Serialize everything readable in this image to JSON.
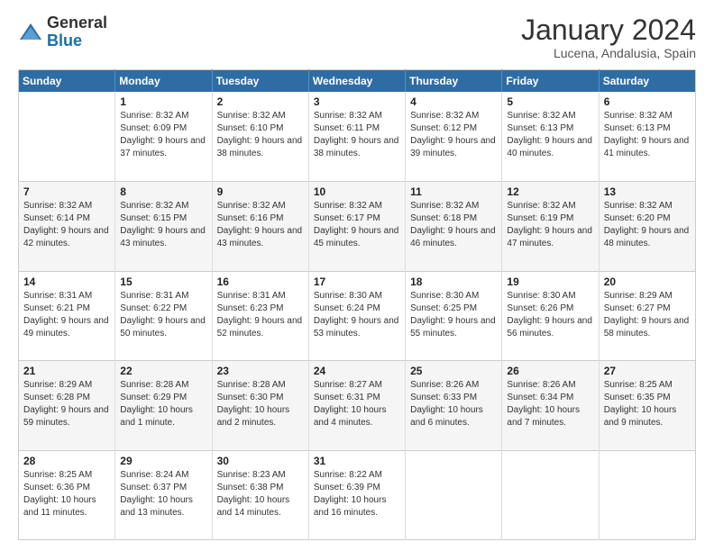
{
  "logo": {
    "general": "General",
    "blue": "Blue"
  },
  "title": "January 2024",
  "subtitle": "Lucena, Andalusia, Spain",
  "days_of_week": [
    "Sunday",
    "Monday",
    "Tuesday",
    "Wednesday",
    "Thursday",
    "Friday",
    "Saturday"
  ],
  "weeks": [
    [
      {
        "day": "",
        "sunrise": "",
        "sunset": "",
        "daylight": ""
      },
      {
        "day": "1",
        "sunrise": "Sunrise: 8:32 AM",
        "sunset": "Sunset: 6:09 PM",
        "daylight": "Daylight: 9 hours and 37 minutes."
      },
      {
        "day": "2",
        "sunrise": "Sunrise: 8:32 AM",
        "sunset": "Sunset: 6:10 PM",
        "daylight": "Daylight: 9 hours and 38 minutes."
      },
      {
        "day": "3",
        "sunrise": "Sunrise: 8:32 AM",
        "sunset": "Sunset: 6:11 PM",
        "daylight": "Daylight: 9 hours and 38 minutes."
      },
      {
        "day": "4",
        "sunrise": "Sunrise: 8:32 AM",
        "sunset": "Sunset: 6:12 PM",
        "daylight": "Daylight: 9 hours and 39 minutes."
      },
      {
        "day": "5",
        "sunrise": "Sunrise: 8:32 AM",
        "sunset": "Sunset: 6:13 PM",
        "daylight": "Daylight: 9 hours and 40 minutes."
      },
      {
        "day": "6",
        "sunrise": "Sunrise: 8:32 AM",
        "sunset": "Sunset: 6:13 PM",
        "daylight": "Daylight: 9 hours and 41 minutes."
      }
    ],
    [
      {
        "day": "7",
        "sunrise": "Sunrise: 8:32 AM",
        "sunset": "Sunset: 6:14 PM",
        "daylight": "Daylight: 9 hours and 42 minutes."
      },
      {
        "day": "8",
        "sunrise": "Sunrise: 8:32 AM",
        "sunset": "Sunset: 6:15 PM",
        "daylight": "Daylight: 9 hours and 43 minutes."
      },
      {
        "day": "9",
        "sunrise": "Sunrise: 8:32 AM",
        "sunset": "Sunset: 6:16 PM",
        "daylight": "Daylight: 9 hours and 43 minutes."
      },
      {
        "day": "10",
        "sunrise": "Sunrise: 8:32 AM",
        "sunset": "Sunset: 6:17 PM",
        "daylight": "Daylight: 9 hours and 45 minutes."
      },
      {
        "day": "11",
        "sunrise": "Sunrise: 8:32 AM",
        "sunset": "Sunset: 6:18 PM",
        "daylight": "Daylight: 9 hours and 46 minutes."
      },
      {
        "day": "12",
        "sunrise": "Sunrise: 8:32 AM",
        "sunset": "Sunset: 6:19 PM",
        "daylight": "Daylight: 9 hours and 47 minutes."
      },
      {
        "day": "13",
        "sunrise": "Sunrise: 8:32 AM",
        "sunset": "Sunset: 6:20 PM",
        "daylight": "Daylight: 9 hours and 48 minutes."
      }
    ],
    [
      {
        "day": "14",
        "sunrise": "Sunrise: 8:31 AM",
        "sunset": "Sunset: 6:21 PM",
        "daylight": "Daylight: 9 hours and 49 minutes."
      },
      {
        "day": "15",
        "sunrise": "Sunrise: 8:31 AM",
        "sunset": "Sunset: 6:22 PM",
        "daylight": "Daylight: 9 hours and 50 minutes."
      },
      {
        "day": "16",
        "sunrise": "Sunrise: 8:31 AM",
        "sunset": "Sunset: 6:23 PM",
        "daylight": "Daylight: 9 hours and 52 minutes."
      },
      {
        "day": "17",
        "sunrise": "Sunrise: 8:30 AM",
        "sunset": "Sunset: 6:24 PM",
        "daylight": "Daylight: 9 hours and 53 minutes."
      },
      {
        "day": "18",
        "sunrise": "Sunrise: 8:30 AM",
        "sunset": "Sunset: 6:25 PM",
        "daylight": "Daylight: 9 hours and 55 minutes."
      },
      {
        "day": "19",
        "sunrise": "Sunrise: 8:30 AM",
        "sunset": "Sunset: 6:26 PM",
        "daylight": "Daylight: 9 hours and 56 minutes."
      },
      {
        "day": "20",
        "sunrise": "Sunrise: 8:29 AM",
        "sunset": "Sunset: 6:27 PM",
        "daylight": "Daylight: 9 hours and 58 minutes."
      }
    ],
    [
      {
        "day": "21",
        "sunrise": "Sunrise: 8:29 AM",
        "sunset": "Sunset: 6:28 PM",
        "daylight": "Daylight: 9 hours and 59 minutes."
      },
      {
        "day": "22",
        "sunrise": "Sunrise: 8:28 AM",
        "sunset": "Sunset: 6:29 PM",
        "daylight": "Daylight: 10 hours and 1 minute."
      },
      {
        "day": "23",
        "sunrise": "Sunrise: 8:28 AM",
        "sunset": "Sunset: 6:30 PM",
        "daylight": "Daylight: 10 hours and 2 minutes."
      },
      {
        "day": "24",
        "sunrise": "Sunrise: 8:27 AM",
        "sunset": "Sunset: 6:31 PM",
        "daylight": "Daylight: 10 hours and 4 minutes."
      },
      {
        "day": "25",
        "sunrise": "Sunrise: 8:26 AM",
        "sunset": "Sunset: 6:33 PM",
        "daylight": "Daylight: 10 hours and 6 minutes."
      },
      {
        "day": "26",
        "sunrise": "Sunrise: 8:26 AM",
        "sunset": "Sunset: 6:34 PM",
        "daylight": "Daylight: 10 hours and 7 minutes."
      },
      {
        "day": "27",
        "sunrise": "Sunrise: 8:25 AM",
        "sunset": "Sunset: 6:35 PM",
        "daylight": "Daylight: 10 hours and 9 minutes."
      }
    ],
    [
      {
        "day": "28",
        "sunrise": "Sunrise: 8:25 AM",
        "sunset": "Sunset: 6:36 PM",
        "daylight": "Daylight: 10 hours and 11 minutes."
      },
      {
        "day": "29",
        "sunrise": "Sunrise: 8:24 AM",
        "sunset": "Sunset: 6:37 PM",
        "daylight": "Daylight: 10 hours and 13 minutes."
      },
      {
        "day": "30",
        "sunrise": "Sunrise: 8:23 AM",
        "sunset": "Sunset: 6:38 PM",
        "daylight": "Daylight: 10 hours and 14 minutes."
      },
      {
        "day": "31",
        "sunrise": "Sunrise: 8:22 AM",
        "sunset": "Sunset: 6:39 PM",
        "daylight": "Daylight: 10 hours and 16 minutes."
      },
      {
        "day": "",
        "sunrise": "",
        "sunset": "",
        "daylight": ""
      },
      {
        "day": "",
        "sunrise": "",
        "sunset": "",
        "daylight": ""
      },
      {
        "day": "",
        "sunrise": "",
        "sunset": "",
        "daylight": ""
      }
    ]
  ]
}
